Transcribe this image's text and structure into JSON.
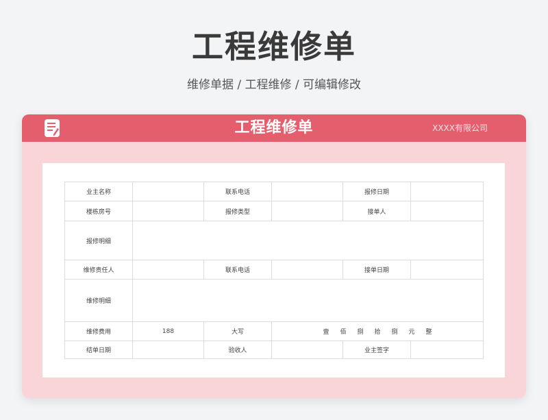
{
  "page": {
    "title": "工程维修单",
    "subtitle": "维修单据 /  工程维修  /  可编辑修改"
  },
  "card": {
    "header_title": "工程维修单",
    "company": "XXXX有限公司",
    "colors": {
      "header": "#e45e6e",
      "card_bg": "#f9d5d8"
    },
    "icon": "document-edit-icon"
  },
  "form": {
    "row1": {
      "label1": "业主名称",
      "label2": "联系电话",
      "label3": "报修日期"
    },
    "row2": {
      "label1": "楼栋房号",
      "label2": "报修类型",
      "label3": "接单人"
    },
    "row3": {
      "label1": "报修明细"
    },
    "row4": {
      "label1": "维修责任人",
      "label2": "联系电话",
      "label3": "接单日期"
    },
    "row5": {
      "label1": "维修明细"
    },
    "row6": {
      "label1": "维修费用",
      "fee_value": "188",
      "label2": "大写",
      "amount_chars": [
        "壹",
        "佰",
        "捌",
        "拾",
        "捌",
        "元",
        "整"
      ]
    },
    "row7": {
      "label1": "结单日期",
      "label2": "验收人",
      "label3": "业主签字"
    }
  }
}
